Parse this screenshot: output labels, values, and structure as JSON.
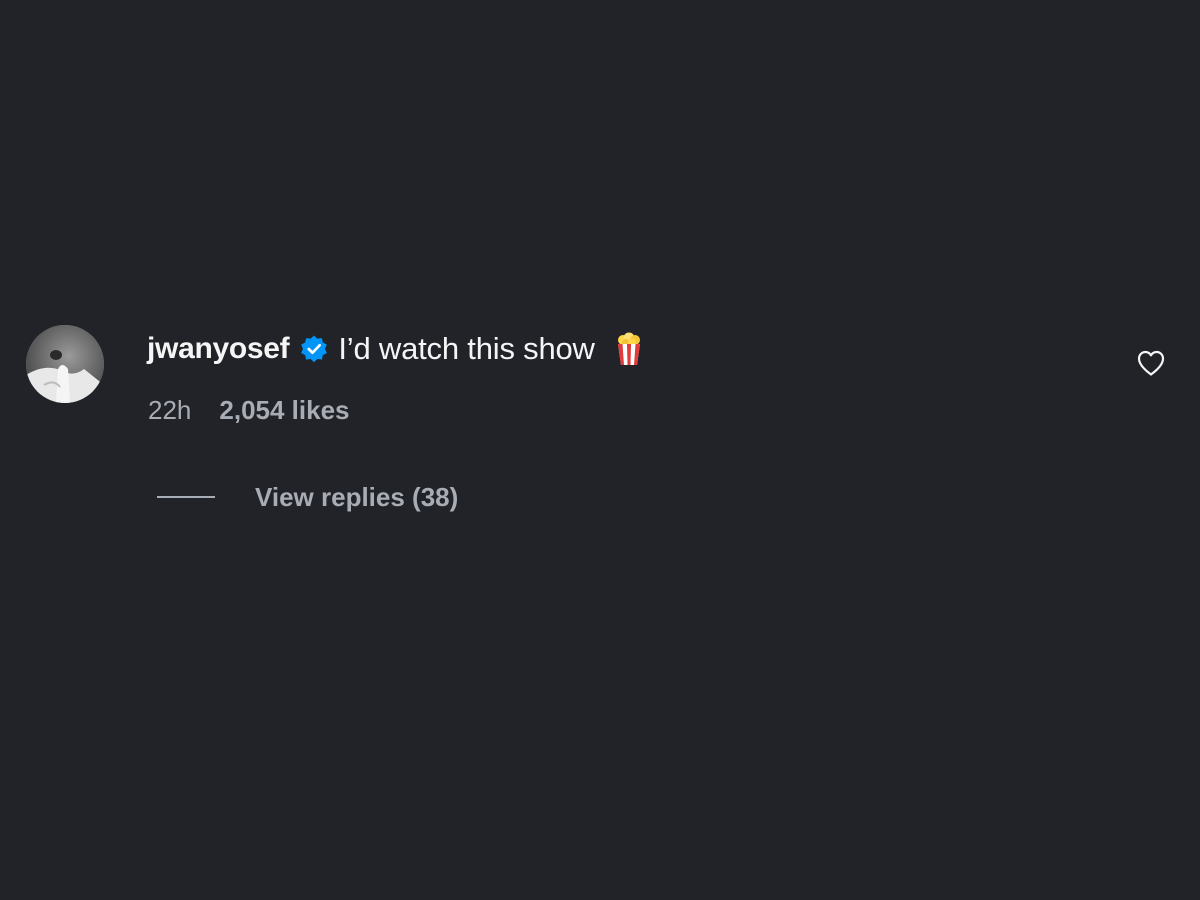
{
  "comment": {
    "username": "jwanyosef",
    "verified": true,
    "text": "I’d watch this show",
    "emoji": "popcorn-icon",
    "time_ago": "22h",
    "likes": "2,054 likes",
    "view_replies": "View replies (38)"
  },
  "icons": {
    "verified": "verified-badge-icon",
    "like": "heart-outline-icon"
  },
  "colors": {
    "background": "#212328",
    "primary_text": "#f5f5f5",
    "secondary_text": "#a8acb4",
    "verified_blue": "#0095f6",
    "popcorn_red": "#e23b3b"
  }
}
